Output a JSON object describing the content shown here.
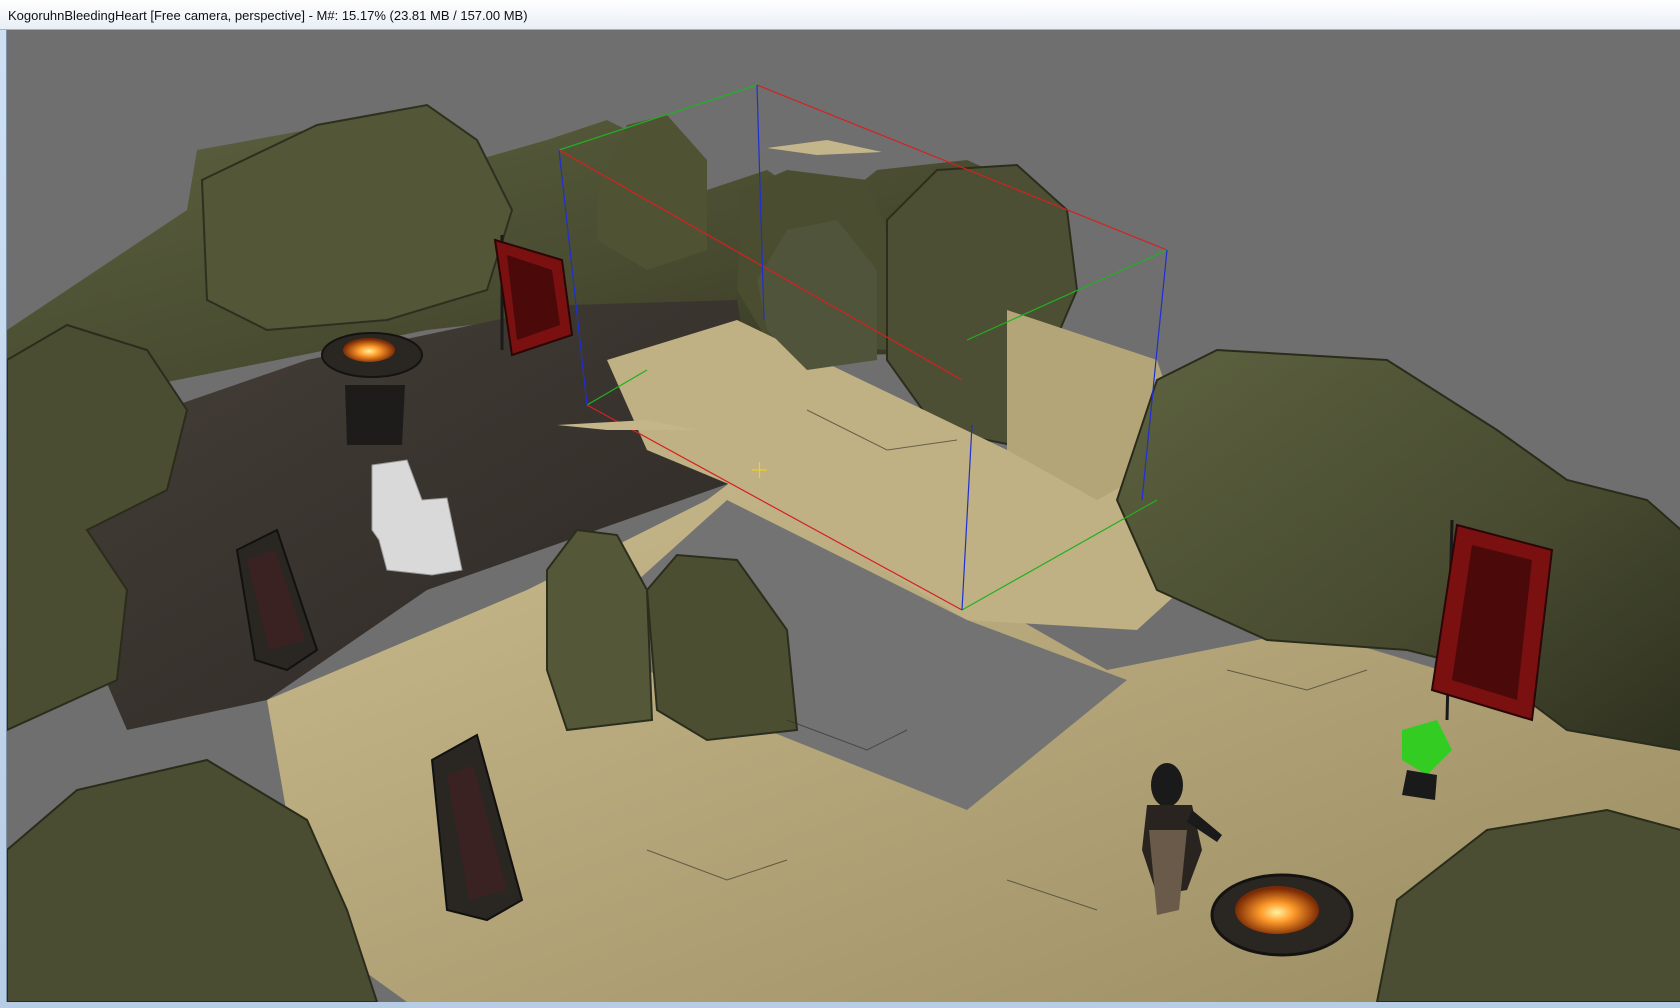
{
  "window": {
    "title": "KogoruhnBleedingHeart [Free camera, perspective] - M#: 15.17% (23.81 MB / 157.00 MB)"
  },
  "viewport": {
    "background_color": "#6f6f6f",
    "scene": "3d-level-editor-view"
  },
  "colors": {
    "rock": "#4f5236",
    "rock_dark": "#363823",
    "sand": "#b5a77b",
    "sand_dark": "#8f8258",
    "dirt": "#3b3632",
    "banner_red": "#7a1010",
    "fire": "#ff7a1a",
    "gizmo_x": "#d62020",
    "gizmo_y": "#21b021",
    "gizmo_z": "#1f2fd0",
    "marker_green": "#33cc22"
  },
  "icons": {
    "cursor": "crosshair-icon"
  }
}
